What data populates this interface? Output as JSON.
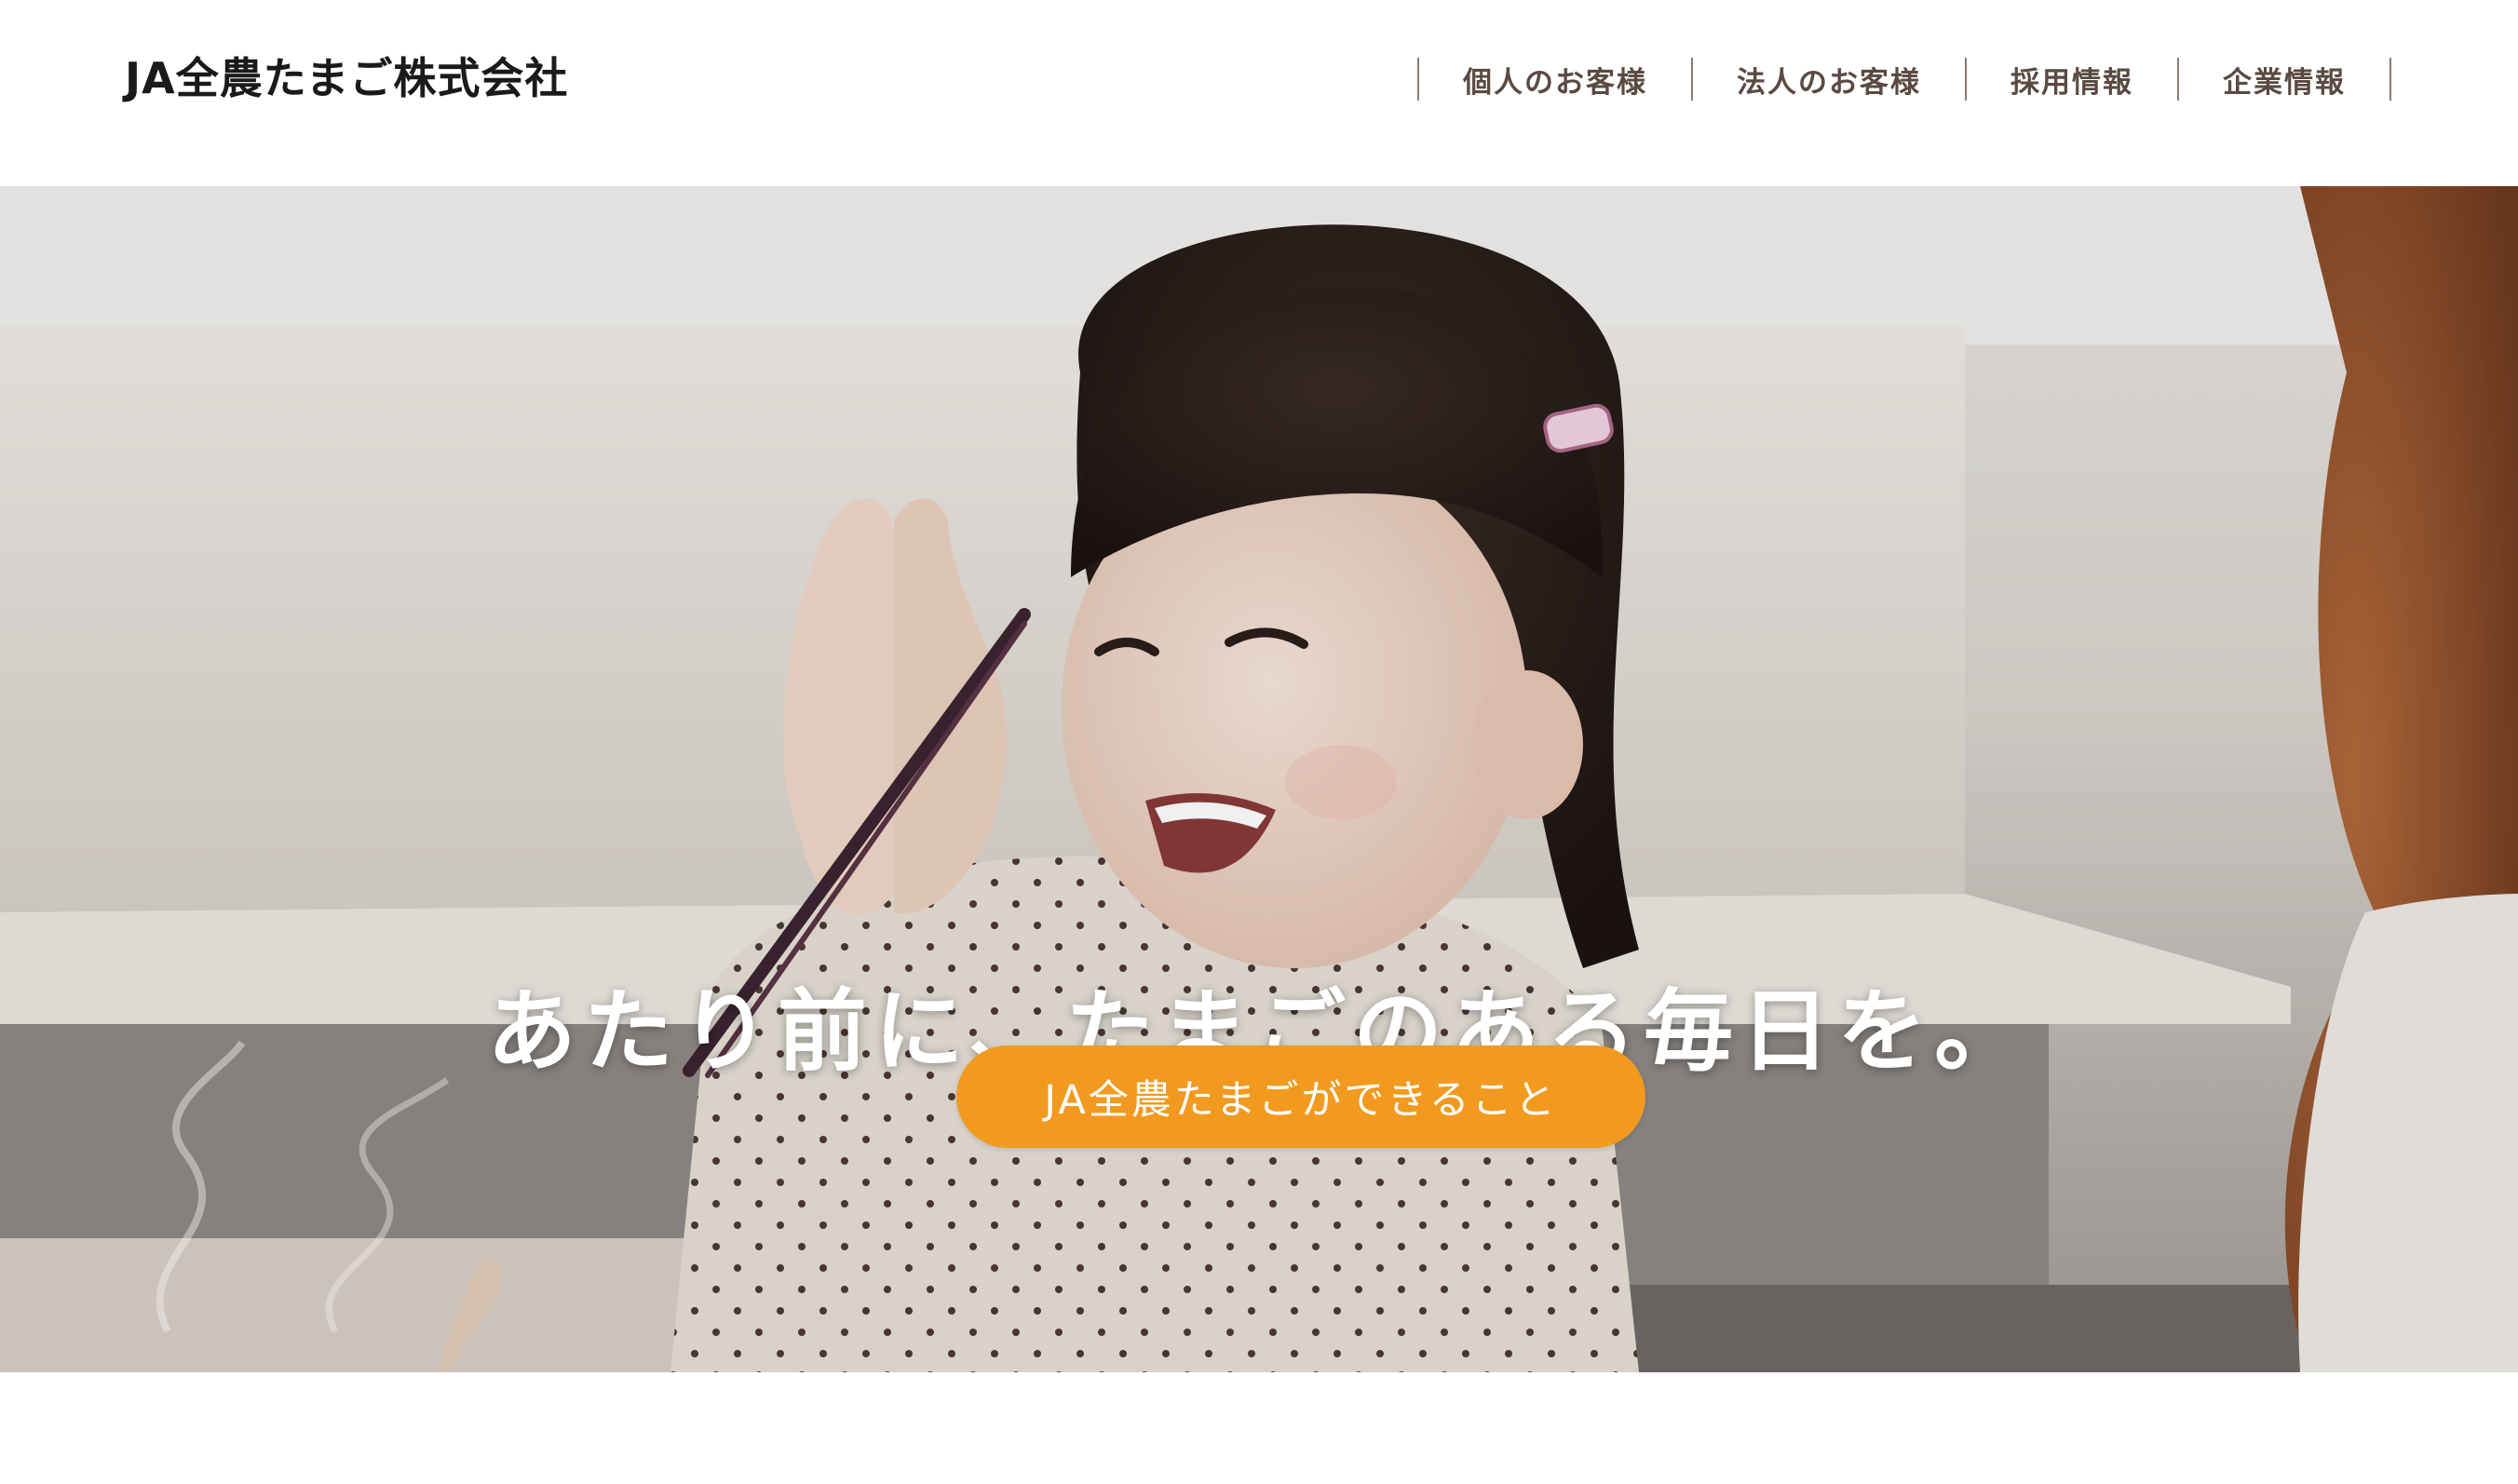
{
  "header": {
    "logo_text": "JA全農たまご株式会社",
    "nav": [
      {
        "label": "個人のお客様"
      },
      {
        "label": "法人のお客様"
      },
      {
        "label": "採用情報"
      },
      {
        "label": "企業情報"
      }
    ]
  },
  "hero": {
    "headline": "あたり前に、たまごのある毎日を。",
    "cta_label": "JA全農たまごができること",
    "image_subject": "smiling-girl-with-hands-together-photo"
  },
  "colors": {
    "cta_background": "#f29a1f",
    "nav_text": "#5a4a42",
    "logo_text": "#1a1a1a"
  }
}
